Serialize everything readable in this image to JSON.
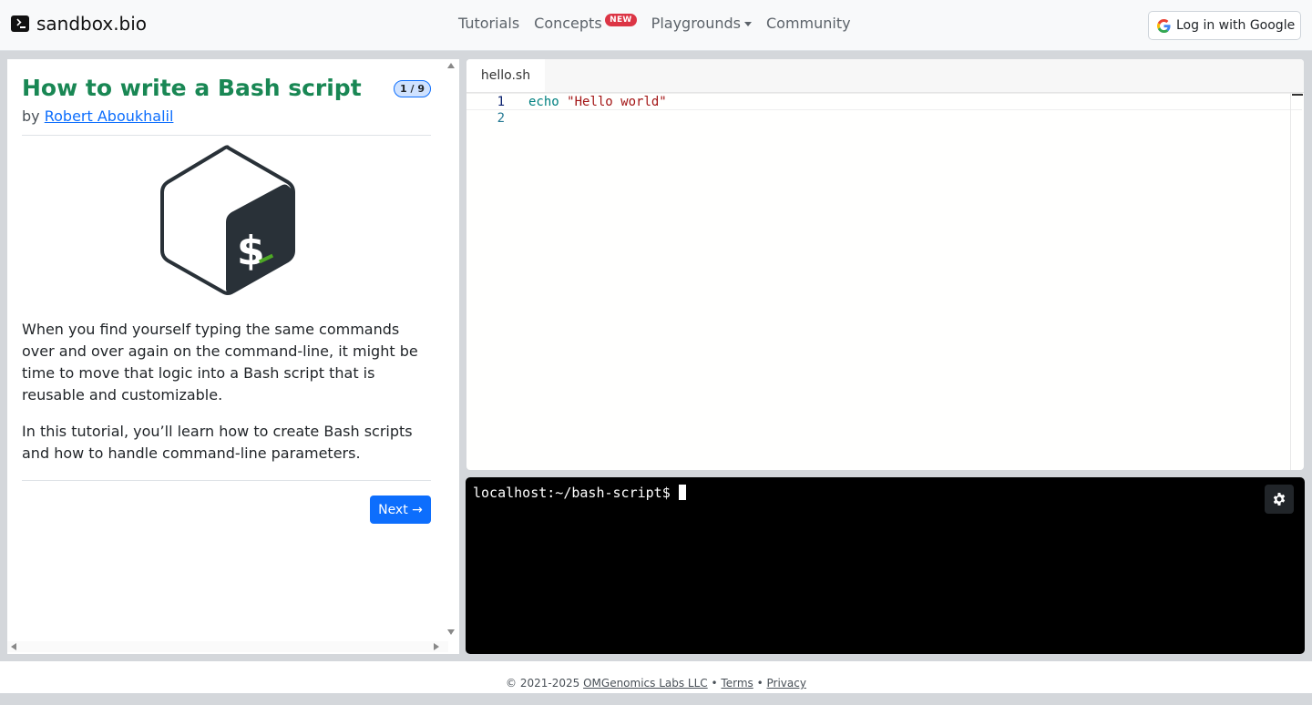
{
  "navbar": {
    "brand": "sandbox.bio",
    "links": {
      "tutorials": "Tutorials",
      "concepts": "Concepts",
      "concepts_badge": "NEW",
      "playgrounds": "Playgrounds",
      "community": "Community"
    },
    "login_label": "Log in with Google"
  },
  "tutorial": {
    "title": "How to write a Bash script",
    "step": "1 / 9",
    "by_prefix": "by",
    "author": "Robert Aboukhalil",
    "logo_icon": "bash-logo-icon",
    "paragraph1": "When you find yourself typing the same commands over and over again on the command-line, it might be time to move that logic into a Bash script that is reusable and customizable.",
    "paragraph2": "In this tutorial, you’ll learn how to create Bash scripts and how to handle command-line parameters.",
    "next_label": "Next →"
  },
  "editor": {
    "tab_label": "hello.sh",
    "lines": [
      {
        "num": "1",
        "keyword": "echo",
        "string": "\"Hello world\""
      },
      {
        "num": "2"
      }
    ]
  },
  "terminal": {
    "prompt": "localhost:~/bash-script$"
  },
  "footer": {
    "copyright": "© 2021-2025",
    "company": "OMGenomics Labs LLC",
    "sep": "•",
    "terms": "Terms",
    "privacy": "Privacy"
  },
  "colors": {
    "title_green": "#198754",
    "primary_blue": "#0d6efd",
    "badge_red": "#dc3545",
    "terminal_bg": "#000000"
  }
}
